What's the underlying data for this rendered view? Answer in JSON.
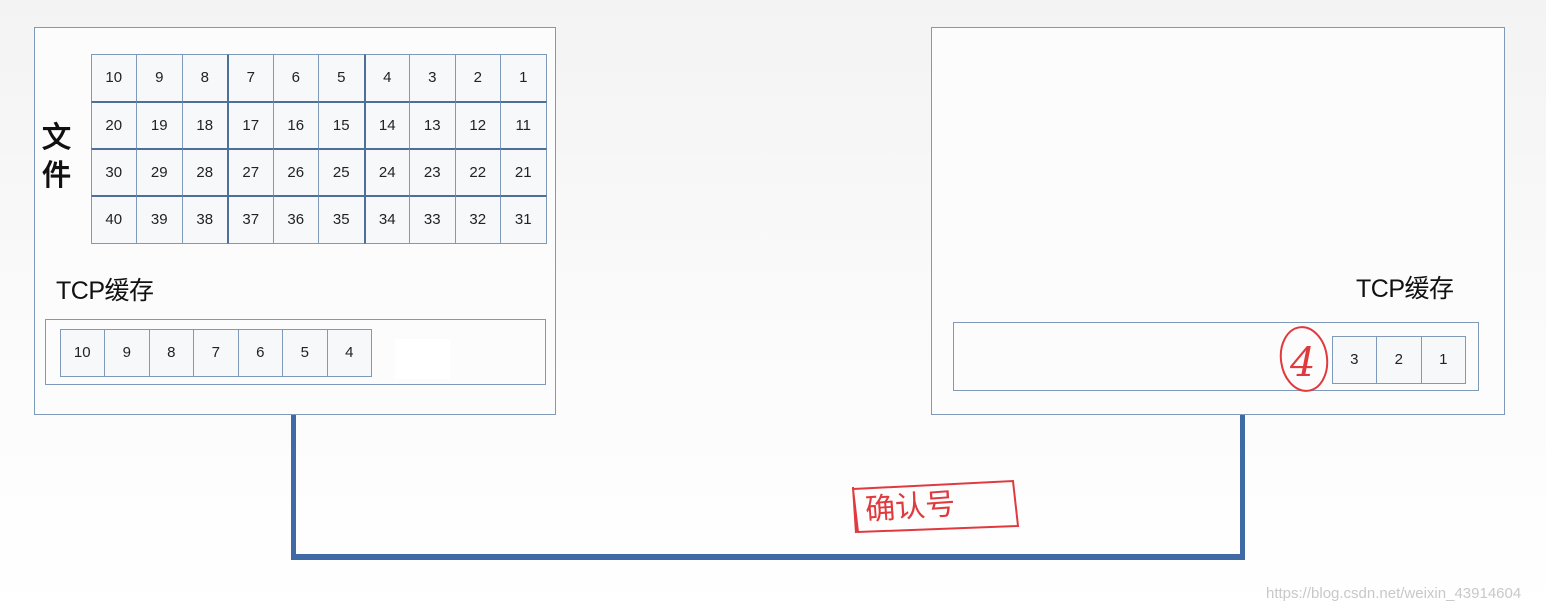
{
  "sender": {
    "file_label": "文件",
    "file_rows": [
      [
        "10",
        "9",
        "8",
        "7",
        "6",
        "5",
        "4",
        "3",
        "2",
        "1"
      ],
      [
        "20",
        "19",
        "18",
        "17",
        "16",
        "15",
        "14",
        "13",
        "12",
        "11"
      ],
      [
        "30",
        "29",
        "28",
        "27",
        "26",
        "25",
        "24",
        "23",
        "22",
        "21"
      ],
      [
        "40",
        "39",
        "38",
        "37",
        "36",
        "35",
        "34",
        "33",
        "32",
        "31"
      ]
    ],
    "tcp_label": "TCP缓存",
    "buffer_cells": [
      "10",
      "9",
      "8",
      "7",
      "6",
      "5",
      "4"
    ]
  },
  "receiver": {
    "tcp_label": "TCP缓存",
    "buffer_cells": [
      "3",
      "2",
      "1"
    ]
  },
  "annotations": {
    "circled_number": "4",
    "ack_note": "确认号"
  },
  "watermark": "https://blog.csdn.net/weixin_43914604",
  "colors": {
    "panel_border": "#7f9ab9",
    "link": "#3f6aa5",
    "annotation": "#e0393e"
  }
}
